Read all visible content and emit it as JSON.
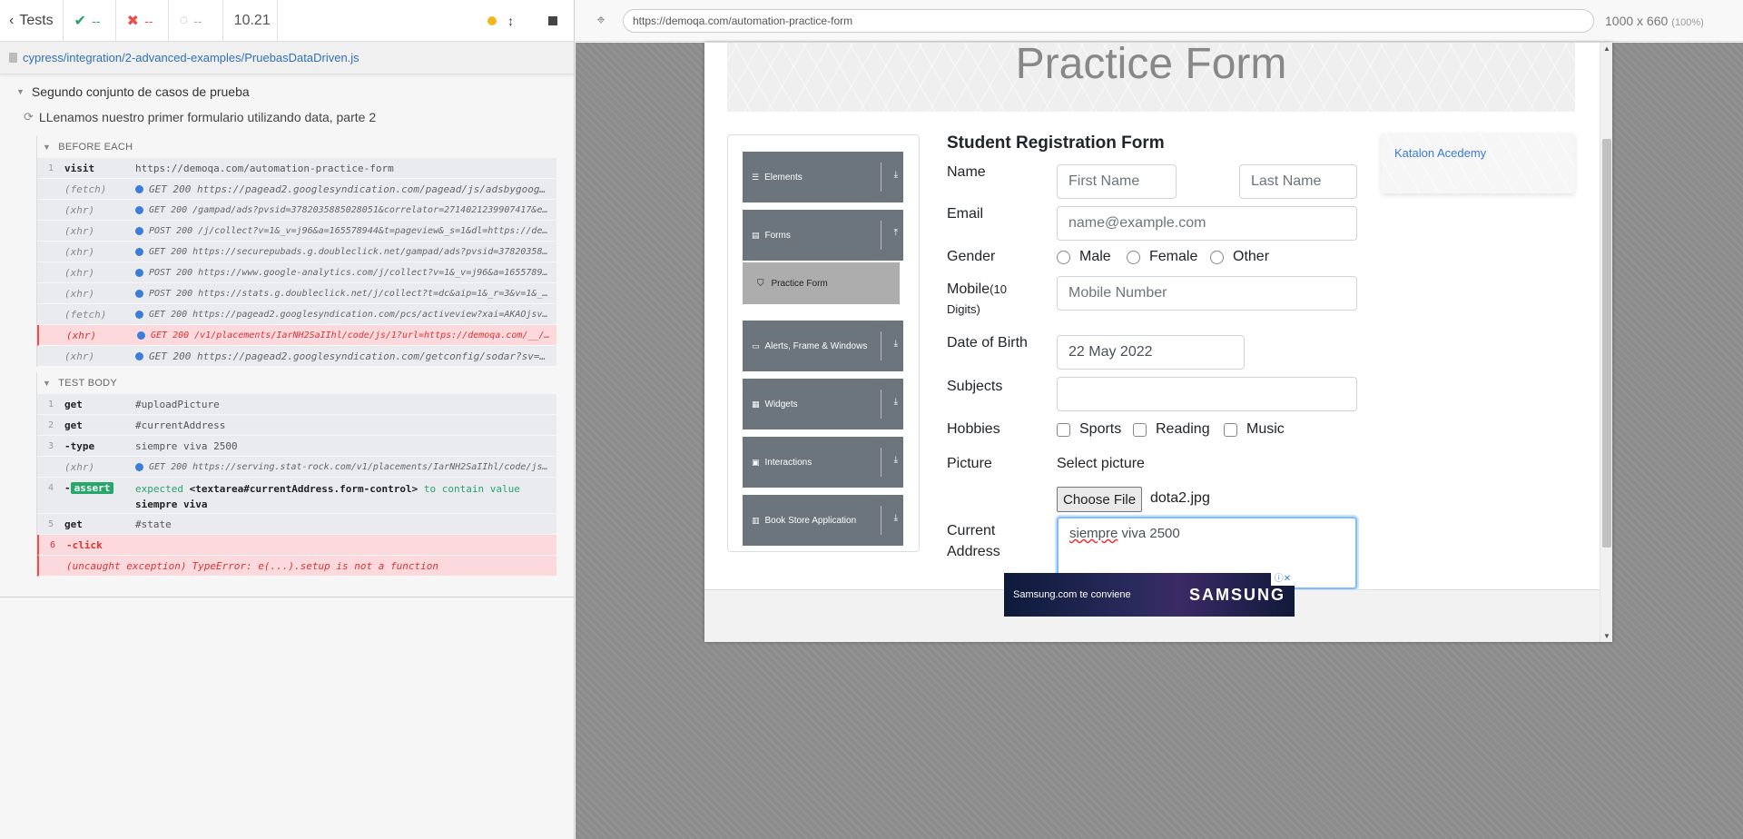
{
  "reporter": {
    "tests_label": "Tests",
    "passed": "--",
    "failed": "--",
    "pending": "--",
    "duration": "10.21",
    "spec_path": "cypress/integration/2-advanced-examples/PruebasDataDriven.js",
    "suite_title": "Segundo conjunto de casos de prueba",
    "test_title": "LLenamos nuestro primer formulario utilizando data, parte 2",
    "before_each_label": "BEFORE EACH",
    "test_body_label": "TEST BODY",
    "before_each_cmds": [
      {
        "num": "1",
        "name": "visit",
        "msg": "https://demoqa.com/automation-practice-form"
      },
      {
        "num": "",
        "name": "(fetch)",
        "msg": "GET 200 https://pagead2.googlesyndication.com/pagead/js/adsbygoog…"
      },
      {
        "num": "",
        "name": "(xhr)",
        "msg": "GET 200 /gampad/ads?pvsid=3782035885028051&correlator=2714021239907417&eid=3…"
      },
      {
        "num": "",
        "name": "(xhr)",
        "msg": "POST 200 /j/collect?v=1&_v=j96&a=165578944&t=pageview&_s=1&dl=https://demoqa…"
      },
      {
        "num": "",
        "name": "(xhr)",
        "msg": "GET 200 https://securepubads.g.doubleclick.net/gampad/ads?pvsid=3782035885028…"
      },
      {
        "num": "",
        "name": "(xhr)",
        "msg": "POST 200 https://www.google-analytics.com/j/collect?v=1&_v=j96&a=165578944&t…"
      },
      {
        "num": "",
        "name": "(xhr)",
        "msg": "POST 200 https://stats.g.doubleclick.net/j/collect?t=dc&aip=1&_r=3&v=1&_v=j9…"
      },
      {
        "num": "",
        "name": "(fetch)",
        "msg": "GET 200 https://pagead2.googlesyndication.com/pcs/activeview?xai=AKAOjsvnLkE…"
      },
      {
        "num": "",
        "name": "(xhr)",
        "msg": "GET 200 /v1/placements/IarNH2SaIIhl/code/js/1?url=https://demoqa.com/__/#/te…"
      },
      {
        "num": "",
        "name": "(xhr)",
        "msg": "GET 200 https://pagead2.googlesyndication.com/getconfig/sodar?sv=…"
      }
    ],
    "test_body_cmds": [
      {
        "num": "1",
        "name": "get",
        "msg": "#uploadPicture"
      },
      {
        "num": "2",
        "name": "get",
        "msg": "#currentAddress"
      },
      {
        "num": "3",
        "name": "-type",
        "msg": "siempre viva 2500"
      },
      {
        "num": "",
        "name": "(xhr)",
        "msg": "GET 200 https://serving.stat-rock.com/v1/placements/IarNH2SaIIhl/code/js/1?u…"
      },
      {
        "num": "4",
        "name": "assert",
        "msg_a": "expected",
        "msg_b": "<textarea#currentAddress.form-control>",
        "msg_c": "to contain value",
        "msg_d": "siempre viva"
      },
      {
        "num": "5",
        "name": "get",
        "msg": "#state"
      },
      {
        "num": "6",
        "name": "-click",
        "msg": ""
      },
      {
        "num": "",
        "name": "(uncaught exception)",
        "msg": "TypeError: e(...).setup is not a function"
      }
    ]
  },
  "aut": {
    "url": "https://demoqa.com/automation-practice-form",
    "viewport": "1000 x 660",
    "zoom": "(100%)",
    "banner_title": "Practice Form",
    "nav": {
      "elements": "Elements",
      "forms": "Forms",
      "practice_form": "Practice Form",
      "alerts": "Alerts, Frame & Windows",
      "widgets": "Widgets",
      "interactions": "Interactions",
      "book_store": "Book Store Application"
    },
    "form": {
      "title": "Student Registration Form",
      "name_label": "Name",
      "first_name_ph": "First Name",
      "last_name_ph": "Last Name",
      "email_label": "Email",
      "email_ph": "name@example.com",
      "gender_label": "Gender",
      "gender_male": "Male",
      "gender_female": "Female",
      "gender_other": "Other",
      "mobile_label": "Mobile",
      "mobile_hint": "(10",
      "mobile_hint2": "Digits)",
      "mobile_ph": "Mobile Number",
      "dob_label": "Date of Birth",
      "dob_value": "22 May 2022",
      "subjects_label": "Subjects",
      "hobbies_label": "Hobbies",
      "hobby_sports": "Sports",
      "hobby_reading": "Reading",
      "hobby_music": "Music",
      "picture_label": "Picture",
      "select_picture": "Select picture",
      "choose_file": "Choose File",
      "file_name": "dota2.jpg",
      "address_label_1": "Current",
      "address_label_2": "Address",
      "address_value_a": "siempre",
      "address_value_b": " viva 2500"
    },
    "ad_link": "Katalon Acedemy",
    "samsung_text": "Samsung.com te conviene",
    "samsung_brand": "SAMSUNG"
  }
}
